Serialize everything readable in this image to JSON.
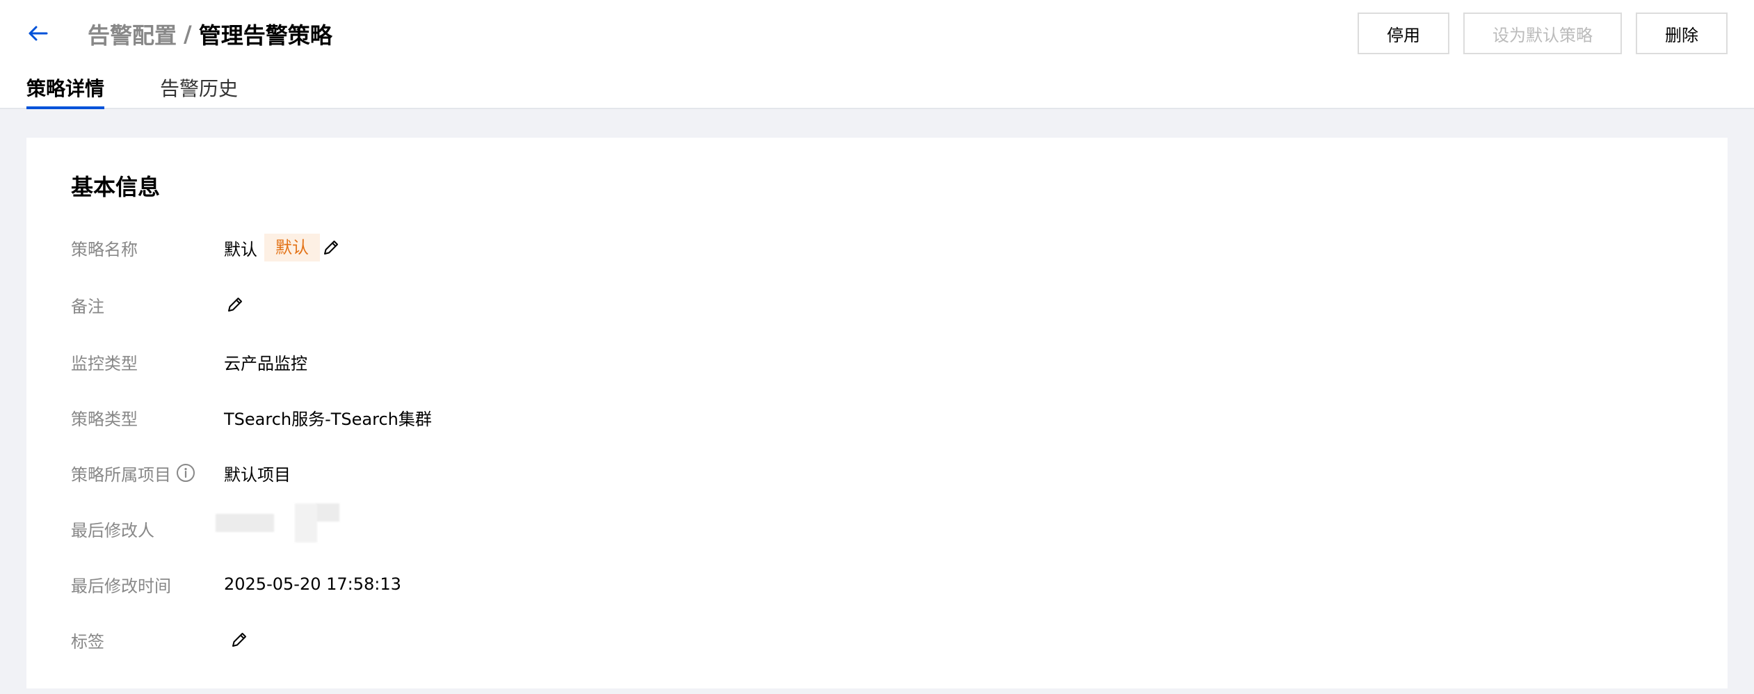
{
  "header": {
    "breadcrumb_parent": "告警配置",
    "breadcrumb_separator": "/",
    "breadcrumb_current": "管理告警策略",
    "actions": {
      "disable_label": "停用",
      "set_default_label": "设为默认策略",
      "delete_label": "删除"
    }
  },
  "tabs": [
    {
      "label": "策略详情",
      "active": true
    },
    {
      "label": "告警历史",
      "active": false
    }
  ],
  "basic_info": {
    "title": "基本信息",
    "fields": {
      "policy_name": {
        "label": "策略名称",
        "value": "默认",
        "tag": "默认"
      },
      "remark": {
        "label": "备注",
        "value": ""
      },
      "monitor_type": {
        "label": "监控类型",
        "value": "云产品监控"
      },
      "policy_type": {
        "label": "策略类型",
        "value": "TSearch服务-TSearch集群"
      },
      "project": {
        "label": "策略所属项目",
        "value": "默认项目"
      },
      "last_modifier": {
        "label": "最后修改人",
        "value": ""
      },
      "last_modified_time": {
        "label": "最后修改时间",
        "value": "2025-05-20 17:58:13"
      },
      "tags": {
        "label": "标签",
        "value": ""
      }
    }
  },
  "colors": {
    "accent": "#0052d9",
    "tag_bg": "#fdf0e4",
    "tag_text": "#e37318",
    "page_bg": "#f1f2f6",
    "label_gray": "#888888"
  },
  "icons": {
    "back": "arrow-left-icon",
    "edit": "pencil-icon",
    "info": "info-circle-icon"
  }
}
